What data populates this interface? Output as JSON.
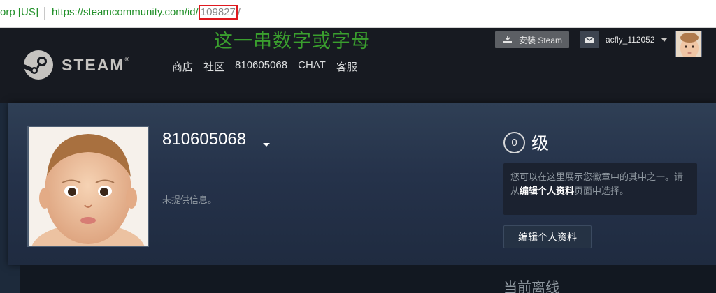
{
  "browser": {
    "ev_label": "orp [US]",
    "url_base": "https://steamcommunity.com/id/",
    "url_highlight": "109827",
    "url_tail": "/"
  },
  "annotation": "这一串数字或字母",
  "header": {
    "logo_text": "STEAM",
    "logo_mark": "®",
    "nav": [
      "商店",
      "社区",
      "810605068",
      "CHAT",
      "客服"
    ],
    "install_label": "安装 Steam",
    "username": "acfly_112052"
  },
  "profile": {
    "name": "810605068",
    "summary": "未提供信息。",
    "level": "0",
    "level_label": "级",
    "badge_text_1": "您可以在这里展示您徽章中的其中之一。请从",
    "badge_link": "编辑个人资料",
    "badge_text_2": "页面中选择。",
    "edit_button": "编辑个人资料",
    "status": "当前离线"
  },
  "colors": {
    "header_bg": "#171a21",
    "url_green": "#1f8f27",
    "highlight_red": "#e0191f",
    "annotation_green": "#3a9f2e",
    "panel_top": "#2f3f55"
  },
  "icons": [
    "steam-logo-icon",
    "download-steam-icon",
    "envelope-icon",
    "dropdown-caret-icon"
  ]
}
